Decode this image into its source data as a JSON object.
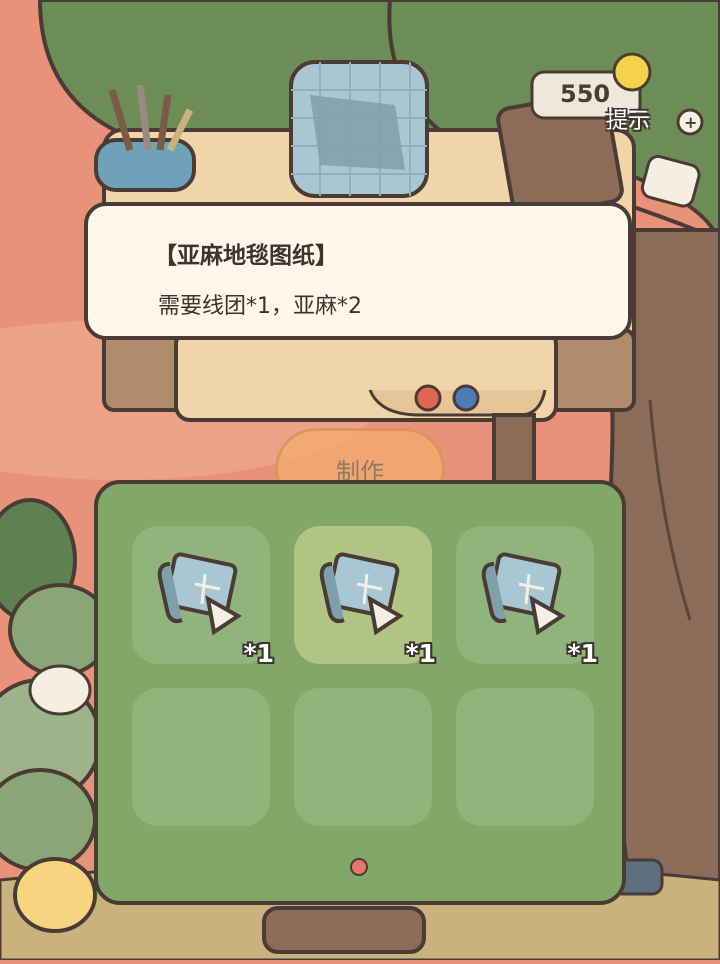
{
  "recipe": {
    "title": "【亚麻地毯图纸】",
    "requirement": "需要线团*1，亚麻*2"
  },
  "craft_button": {
    "label": "制作"
  },
  "hint": {
    "label": "提示",
    "count_visible": "550"
  },
  "inventory": {
    "slots": [
      {
        "item": "blueprint-icon",
        "count": "*1",
        "selected": false
      },
      {
        "item": "blueprint-icon",
        "count": "*1",
        "selected": true
      },
      {
        "item": "blueprint-icon",
        "count": "*1",
        "selected": false
      },
      {
        "item": "",
        "count": "",
        "selected": false
      },
      {
        "item": "",
        "count": "",
        "selected": false
      },
      {
        "item": "",
        "count": "",
        "selected": false
      }
    ],
    "pages": 1
  },
  "colors": {
    "background": "#e8927a",
    "panel": "#81a869",
    "tooltip": "#fdf8ea",
    "outline": "#4a3b35",
    "craft_button": "#f4ac6c"
  }
}
